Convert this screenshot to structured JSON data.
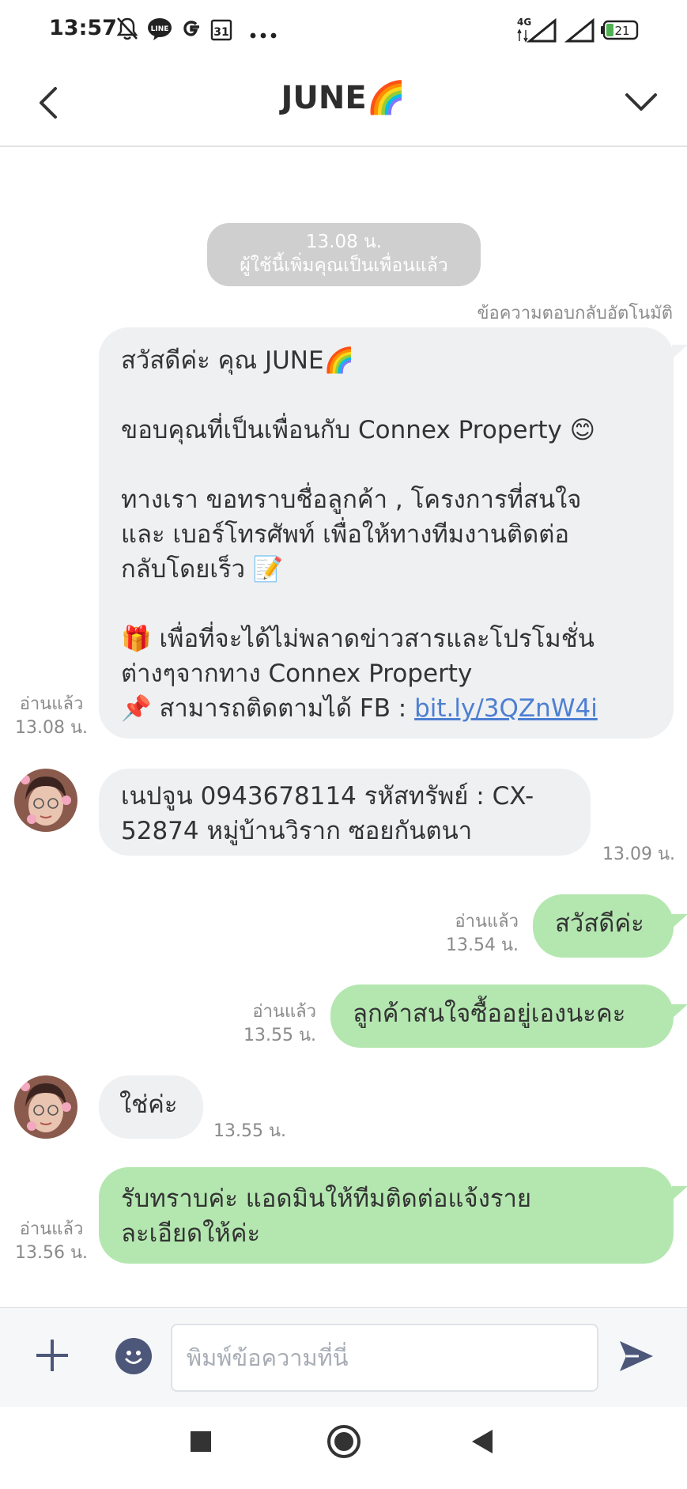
{
  "status_bar": {
    "time": "13:57",
    "icons": [
      "bell-off-icon",
      "line-app-icon",
      "google-icon",
      "calendar-icon",
      "more-dots-icon",
      "signal-4g-icon",
      "signal-icon",
      "battery-icon"
    ],
    "calendar_day": "31",
    "network": "4G",
    "battery": "21"
  },
  "header": {
    "title": "JUNE🌈",
    "back_icon": "chevron-left-icon",
    "menu_icon": "chevron-down-icon"
  },
  "chat": {
    "system": {
      "time": "13.08 น.",
      "text": "ผู้ใช้นี้เพิ่มคุณเป็นเพื่อนแล้ว"
    },
    "auto_reply_label": "ข้อความตอบกลับอัตโนมัติ",
    "welcome": {
      "line1": "สวัสดีค่ะ คุณ JUNE🌈",
      "line2": "ขอบคุณที่เป็นเพื่อนกับ Connex Property 😊",
      "line3": "ทางเรา ขอทราบชื่อลูกค้า , โครงการที่สนใจ",
      "line4": "และ เบอร์โทรศัพท์ เพื่อให้ทางทีมงานติดต่อ",
      "line5": "กลับโดยเร็ว 📝",
      "line6": "🎁 เพื่อที่จะได้ไม่พลาดข่าวสารและโปรโมชั่น",
      "line7": "ต่างๆจากทาง Connex Property",
      "line8_prefix": "📌 สามารถติดตามได้ FB : ",
      "link": "bit.ly/3QZnW4i",
      "read": "อ่านแล้ว",
      "time": "13.08 น."
    },
    "msg_in_1": {
      "line1": "เนปจูน 0943678114 รหัสทรัพย์ : CX-",
      "line2": "52874 หมู่บ้านวิราก ซอยกันตนา",
      "time": "13.09 น."
    },
    "msg_out_1": {
      "text": "สวัสดีค่ะ",
      "read": "อ่านแล้ว",
      "time": "13.54 น."
    },
    "msg_out_2": {
      "text": "ลูกค้าสนใจซื้ออยู่เองนะคะ",
      "read": "อ่านแล้ว",
      "time": "13.55 น."
    },
    "msg_in_2": {
      "text": "ใช่ค่ะ",
      "time": "13.55 น."
    },
    "msg_out_3": {
      "line1": "รับทราบค่ะ แอดมินให้ทีมติดต่อแจ้งราย",
      "line2": "ละเอียดให้ค่ะ",
      "read": "อ่านแล้ว",
      "time": "13.56 น."
    }
  },
  "input": {
    "placeholder": "พิมพ์ข้อความที่นี่",
    "value": ""
  },
  "nav": {
    "icons": [
      "recent-apps-icon",
      "home-icon",
      "back-icon"
    ]
  },
  "colors": {
    "incoming_bubble": "#eff0f2",
    "outgoing_bubble": "#b4e7b0",
    "system_pill": "#cfcfcf",
    "link": "#4d7fd2",
    "send_icon": "#4c5779"
  }
}
